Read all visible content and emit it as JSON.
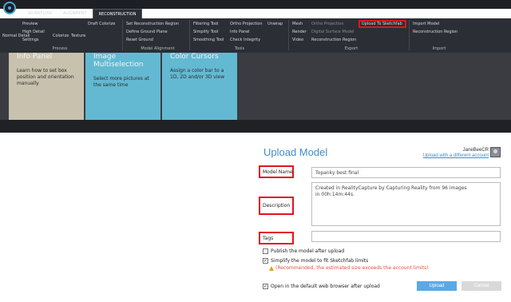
{
  "app": {
    "tabs": [
      "WORKFLOW",
      "ALIGNMENT",
      "RECONSTRUCTION"
    ],
    "active_tab": "RECONSTRUCTION",
    "ribbon": {
      "normal_detail": "Normal Detail",
      "preview": "Preview",
      "high_detail": "High Detail",
      "settings": "Settings",
      "colorize": "Colorize",
      "texture": "Texture",
      "draft_colorize": "Draft Colorize",
      "set_recon_region": "Set Reconstruction Region",
      "define_ground_plane": "Define Ground Plane",
      "reset_ground": "Reset Ground",
      "filtering_tool": "Filtering Tool",
      "simplify_tool": "Simplify Tool",
      "smoothing_tool": "Smoothing Tool",
      "ortho_projection": "Ortho Projection",
      "info_panel": "Info Panel",
      "check_integrity": "Check Integrity",
      "unwrap": "Unwrap",
      "mesh": "Mesh",
      "render": "Render",
      "video": "Video",
      "ortho_projection_2": "Ortho Projection",
      "digital_surface_model": "Digital Surface Model",
      "reconstruction_region": "Reconstruction Region",
      "upload_sketchfab": "Upload To Sketchfab",
      "import_model": "Import Model",
      "reconstruction_region_2": "Reconstruction Region"
    },
    "groups": {
      "process": "Process",
      "model_alignment": "Model Alignment",
      "tools": "Tools",
      "export": "Export",
      "import": "Import"
    },
    "cards": [
      {
        "title": "Info Panel",
        "desc": "Learn how to set box position and orientation manually"
      },
      {
        "title": "Image Multiselection",
        "desc": "Select more pictures at the same time"
      },
      {
        "title": "Color Cursors",
        "desc": "Assign a color bar to a 1D, 2D and/or 3D view"
      }
    ]
  },
  "dialog": {
    "title": "Upload Model",
    "user_name": "JaneBeeCR",
    "user_link": "Upload with a different account",
    "model_name_label": "Model Name",
    "model_name_value": "Topanky best final",
    "description_label": "Description",
    "description_value": "Created in RealityCapture by Capturing Reality from 96 images in 00h:14m:44s.",
    "tags_label": "Tags",
    "tags_value": "",
    "publish_label": "Publish the model after upload",
    "publish_checked": false,
    "simplify_label": "Simplify the model to fit Sketchfab limits",
    "simplify_checked": true,
    "warning_text": "(Recommended, the estimated size exceeds the account limits)",
    "open_browser_label": "Open in the default web browser after upload",
    "open_browser_checked": true,
    "upload_button": "Upload",
    "cancel_button": "Cancel"
  },
  "colors": {
    "accent": "#3b8ecb",
    "highlight": "#e0141e",
    "warning": "#e0533a"
  }
}
